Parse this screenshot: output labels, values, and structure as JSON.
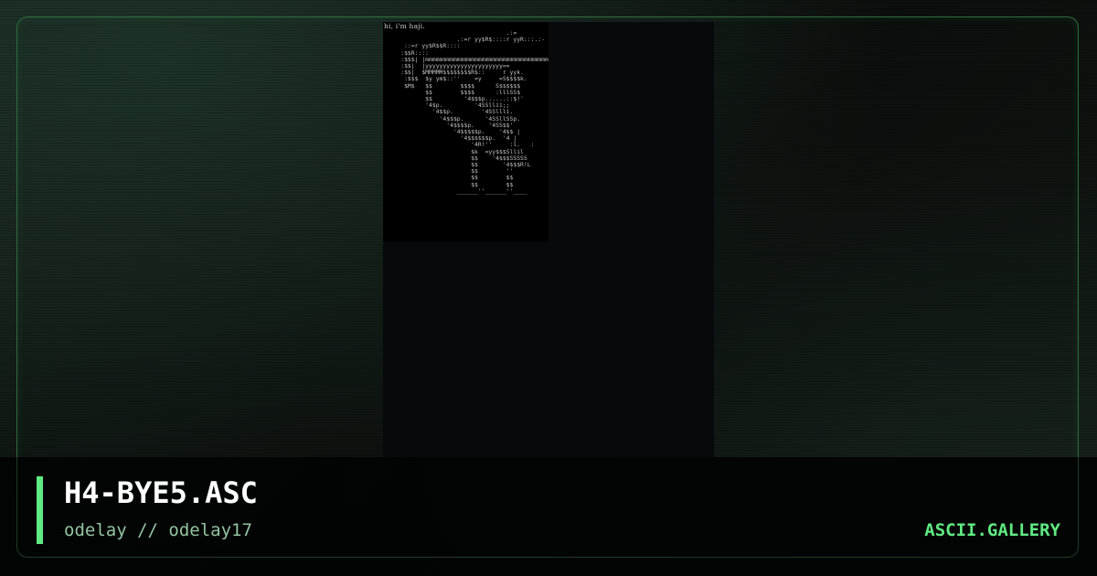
{
  "artwork": {
    "title": "H4-BYE5.ASC",
    "byline": "odelay // odelay17",
    "caption": "hi, i'm haji.",
    "ascii_lines": [
      "                                   .:=",
      "                     .:=r yy$R$::::r yyR:::.:-",
      "      ::=r yy$R$$R::::",
      "     :$$R::::",
      "     :$$$| |mmmmmmmmmmmmmmmmmmmmmmmmmmmmmmmmmmm",
      "     :$$|  |yyyyyyyyyyyyyyyyyyyyyy==",
      "     :$$|  $MMMMM$$$$$$$$R$::     r yyk.",
      "      :$$$  $y ym$::''    =y     =S$$$$k.",
      "      $M$   $$        $$$$      S$$$$$$",
      "            $$        $$$$      :lllSS$",
      "            $$         '4$$$p......::$!'",
      "            '4$p.         '4SSllii;;",
      "              '4$$p.        '4SSllli.",
      "                '4$$$p.      '4SSllSSp.",
      "                  '4$$$$p.    '4SS$$'",
      "                    '4$$$$$p.    '4$$ |",
      "                      '4$$$$$$p.  '4 |",
      "                         '4R!''     :l.   :",
      "                         $k  =yy$$$Sllil",
      "                         $$    '4$$$SSSSS",
      "                         $$       '4$$$R!L",
      "                         $$        ''",
      "                         $$        $$",
      "                         $$        $$",
      "                     ______''______''____"
    ]
  },
  "site": {
    "brand": "ASCII.GALLERY"
  },
  "colors": {
    "accent": "#5fea82",
    "frame": "#2f6b3d",
    "subtitle": "#93c49f",
    "title": "#ffffff"
  }
}
